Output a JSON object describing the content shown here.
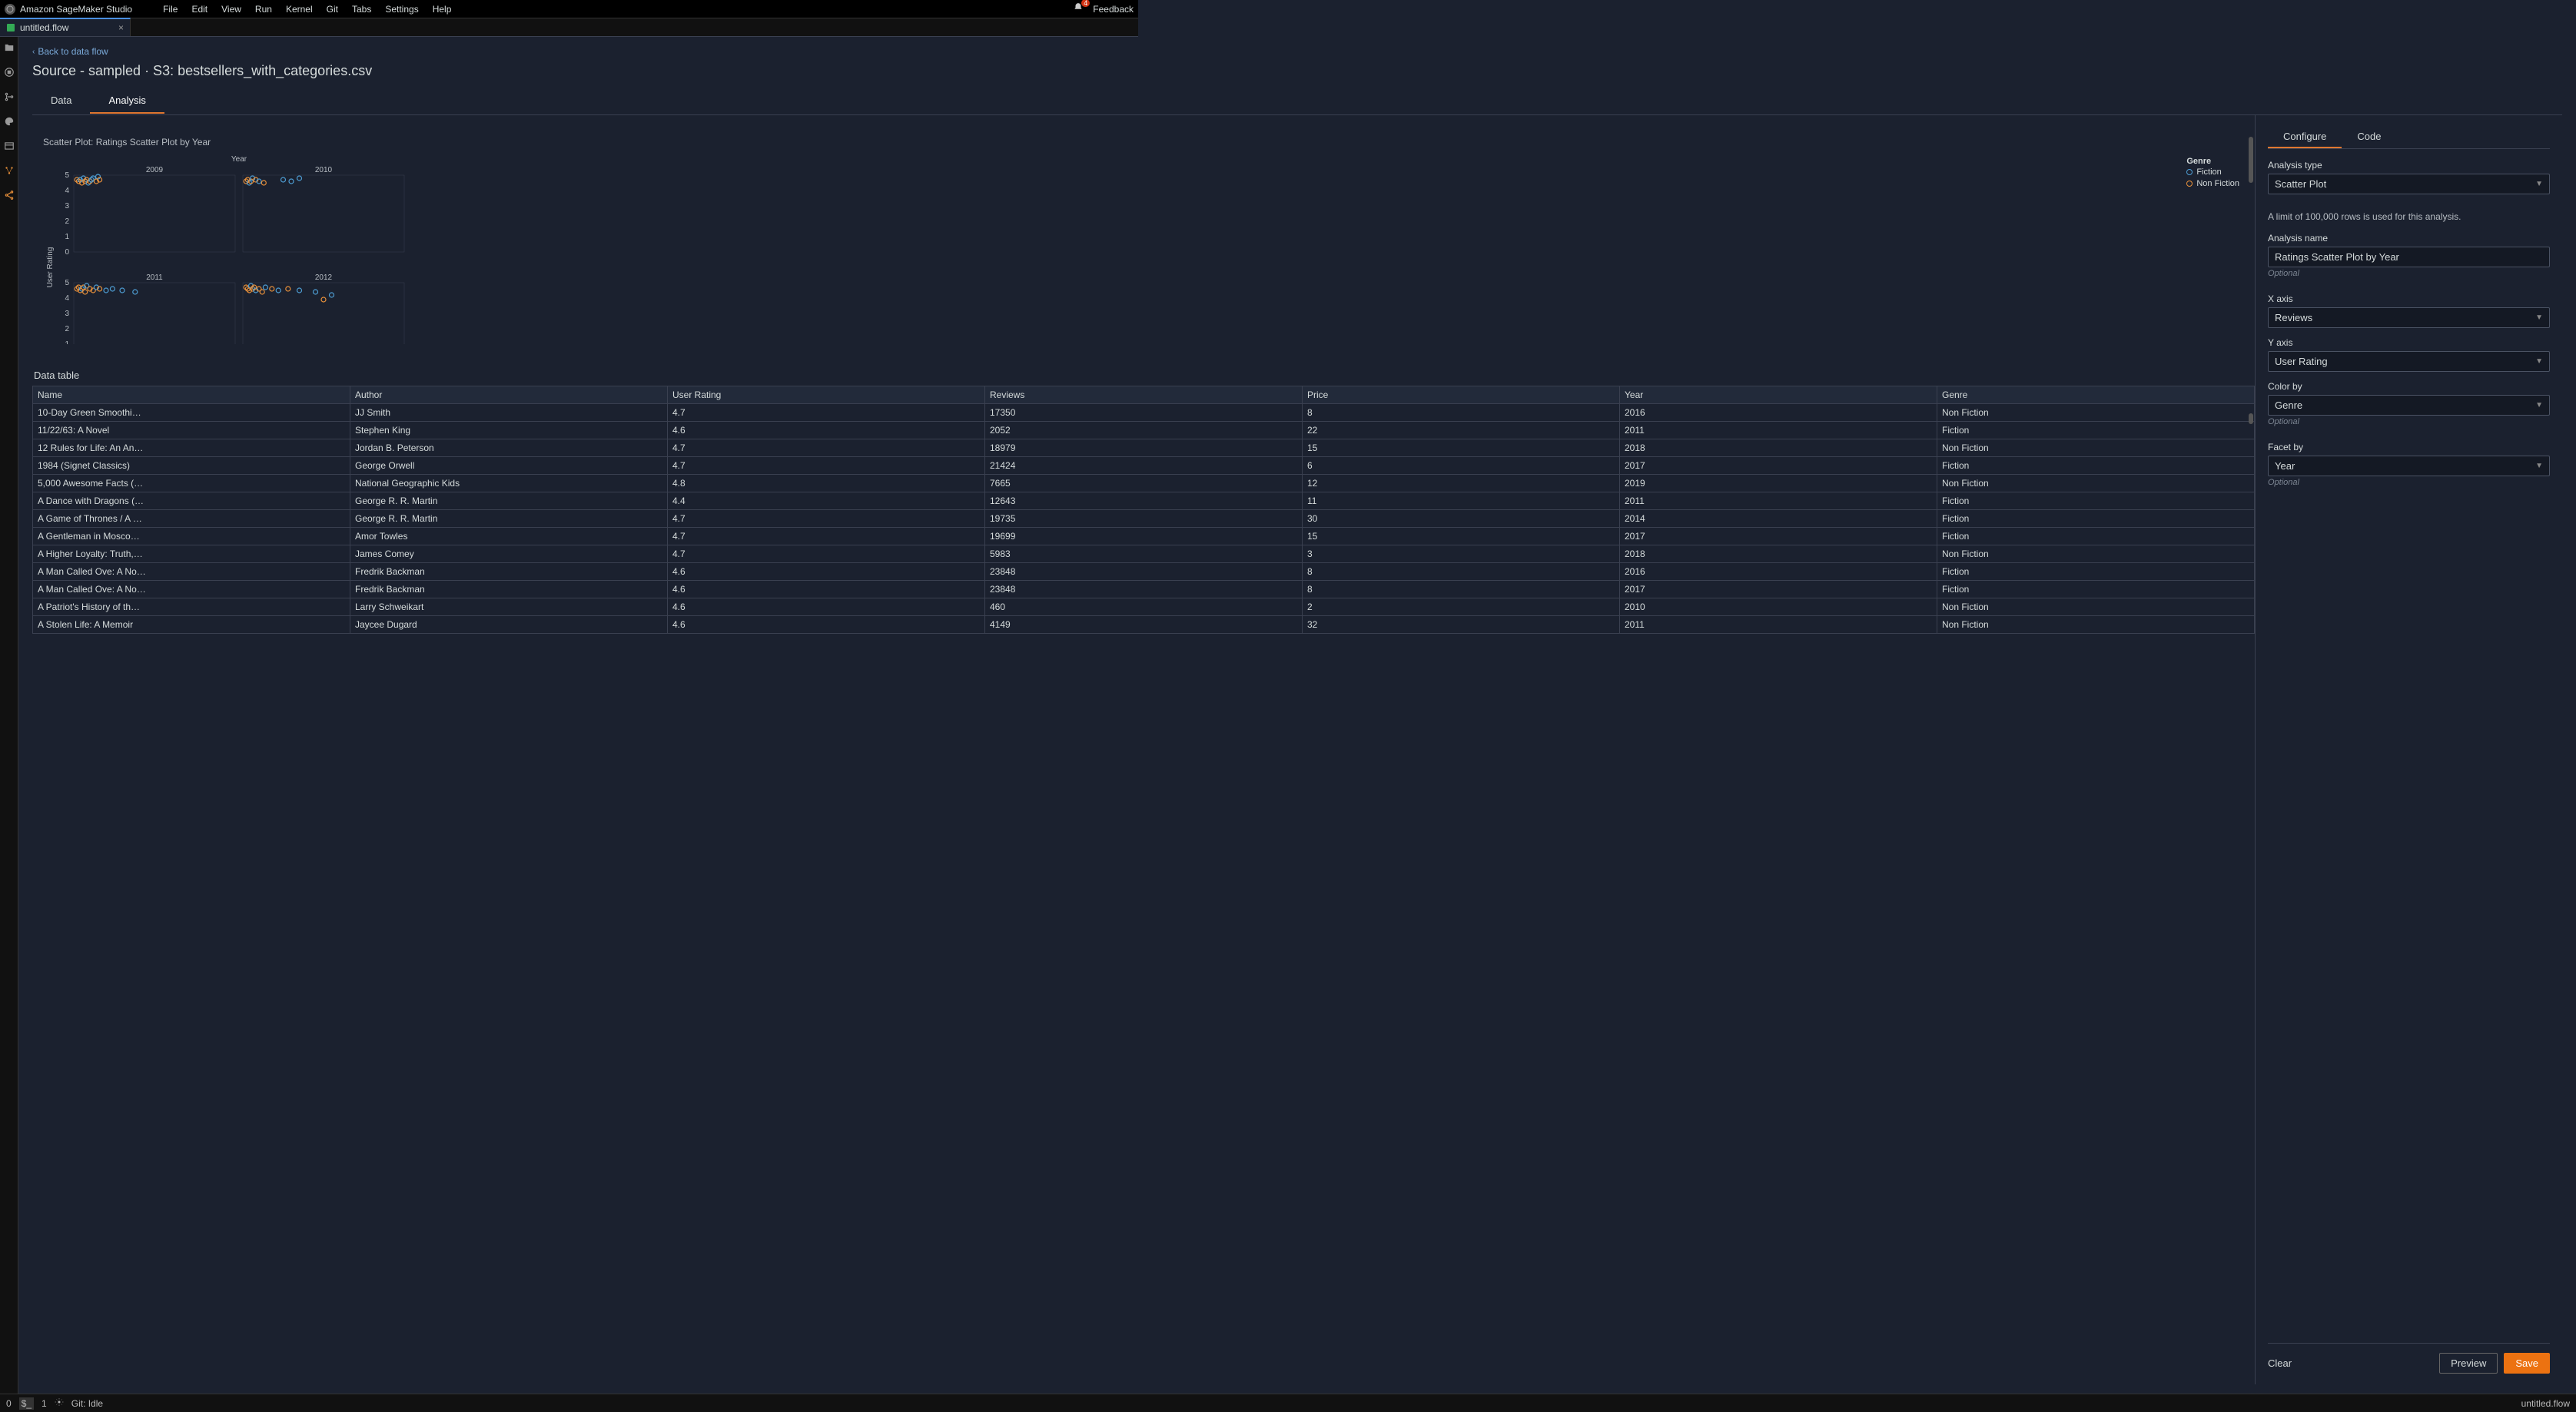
{
  "app": {
    "title": "Amazon SageMaker Studio",
    "feedback": "Feedback",
    "notification_count": "4"
  },
  "menu": [
    "File",
    "Edit",
    "View",
    "Run",
    "Kernel",
    "Git",
    "Tabs",
    "Settings",
    "Help"
  ],
  "tab": {
    "label": "untitled.flow"
  },
  "back_link": "Back to data flow",
  "page_title": "Source - sampled · S3: bestsellers_with_categories.csv",
  "view_tabs": {
    "data": "Data",
    "analysis": "Analysis"
  },
  "chart": {
    "title": "Scatter Plot: Ratings Scatter Plot by Year",
    "top_axis": "Year",
    "y_axis": "User Rating"
  },
  "legend": {
    "title": "Genre",
    "items": [
      "Fiction",
      "Non Fiction"
    ]
  },
  "data_table_label": "Data table",
  "columns": [
    "Name",
    "Author",
    "User Rating",
    "Reviews",
    "Price",
    "Year",
    "Genre"
  ],
  "rows": [
    {
      "name": "10-Day Green Smoothi…",
      "author": "JJ Smith",
      "rating": "4.7",
      "reviews": "17350",
      "price": "8",
      "year": "2016",
      "genre": "Non Fiction"
    },
    {
      "name": "11/22/63: A Novel",
      "author": "Stephen King",
      "rating": "4.6",
      "reviews": "2052",
      "price": "22",
      "year": "2011",
      "genre": "Fiction"
    },
    {
      "name": "12 Rules for Life: An An…",
      "author": "Jordan B. Peterson",
      "rating": "4.7",
      "reviews": "18979",
      "price": "15",
      "year": "2018",
      "genre": "Non Fiction"
    },
    {
      "name": "1984 (Signet Classics)",
      "author": "George Orwell",
      "rating": "4.7",
      "reviews": "21424",
      "price": "6",
      "year": "2017",
      "genre": "Fiction"
    },
    {
      "name": "5,000 Awesome Facts (…",
      "author": "National Geographic Kids",
      "rating": "4.8",
      "reviews": "7665",
      "price": "12",
      "year": "2019",
      "genre": "Non Fiction"
    },
    {
      "name": "A Dance with Dragons (…",
      "author": "George R. R. Martin",
      "rating": "4.4",
      "reviews": "12643",
      "price": "11",
      "year": "2011",
      "genre": "Fiction"
    },
    {
      "name": "A Game of Thrones / A …",
      "author": "George R. R. Martin",
      "rating": "4.7",
      "reviews": "19735",
      "price": "30",
      "year": "2014",
      "genre": "Fiction"
    },
    {
      "name": "A Gentleman in Mosco…",
      "author": "Amor Towles",
      "rating": "4.7",
      "reviews": "19699",
      "price": "15",
      "year": "2017",
      "genre": "Fiction"
    },
    {
      "name": "A Higher Loyalty: Truth,…",
      "author": "James Comey",
      "rating": "4.7",
      "reviews": "5983",
      "price": "3",
      "year": "2018",
      "genre": "Non Fiction"
    },
    {
      "name": "A Man Called Ove: A No…",
      "author": "Fredrik Backman",
      "rating": "4.6",
      "reviews": "23848",
      "price": "8",
      "year": "2016",
      "genre": "Fiction"
    },
    {
      "name": "A Man Called Ove: A No…",
      "author": "Fredrik Backman",
      "rating": "4.6",
      "reviews": "23848",
      "price": "8",
      "year": "2017",
      "genre": "Fiction"
    },
    {
      "name": "A Patriot's History of th…",
      "author": "Larry Schweikart",
      "rating": "4.6",
      "reviews": "460",
      "price": "2",
      "year": "2010",
      "genre": "Non Fiction"
    },
    {
      "name": "A Stolen Life: A Memoir",
      "author": "Jaycee Dugard",
      "rating": "4.6",
      "reviews": "4149",
      "price": "32",
      "year": "2011",
      "genre": "Non Fiction"
    }
  ],
  "config": {
    "tabs": {
      "configure": "Configure",
      "code": "Code"
    },
    "analysis_type_label": "Analysis type",
    "analysis_type": "Scatter Plot",
    "info": "A limit of 100,000 rows is used for this analysis.",
    "analysis_name_label": "Analysis name",
    "analysis_name": "Ratings Scatter Plot by Year",
    "optional": "Optional",
    "x_axis_label": "X axis",
    "x_axis": "Reviews",
    "y_axis_label": "Y axis",
    "y_axis": "User Rating",
    "color_by_label": "Color by",
    "color_by": "Genre",
    "facet_by_label": "Facet by",
    "facet_by": "Year",
    "clear": "Clear",
    "preview": "Preview",
    "save": "Save"
  },
  "status": {
    "zero": "0",
    "one": "1",
    "git": "Git: Idle",
    "file": "untitled.flow"
  },
  "chart_data": {
    "type": "scatter",
    "facets": [
      "2009",
      "2010",
      "2011",
      "2012"
    ],
    "y_ticks": [
      0,
      1,
      2,
      3,
      4,
      5
    ],
    "color_categories": [
      "Fiction",
      "Non Fiction"
    ],
    "colors": {
      "Fiction": "#4e9ed4",
      "Non Fiction": "#e8903a"
    },
    "panels": [
      {
        "facet": "2009",
        "points": [
          {
            "x": 0.02,
            "y": 4.7,
            "c": "Non Fiction"
          },
          {
            "x": 0.03,
            "y": 4.6,
            "c": "Non Fiction"
          },
          {
            "x": 0.04,
            "y": 4.7,
            "c": "Fiction"
          },
          {
            "x": 0.05,
            "y": 4.5,
            "c": "Non Fiction"
          },
          {
            "x": 0.06,
            "y": 4.8,
            "c": "Fiction"
          },
          {
            "x": 0.07,
            "y": 4.6,
            "c": "Non Fiction"
          },
          {
            "x": 0.08,
            "y": 4.7,
            "c": "Non Fiction"
          },
          {
            "x": 0.09,
            "y": 4.5,
            "c": "Fiction"
          },
          {
            "x": 0.1,
            "y": 4.6,
            "c": "Non Fiction"
          },
          {
            "x": 0.11,
            "y": 4.7,
            "c": "Fiction"
          },
          {
            "x": 0.12,
            "y": 4.8,
            "c": "Fiction"
          },
          {
            "x": 0.14,
            "y": 4.6,
            "c": "Non Fiction"
          },
          {
            "x": 0.15,
            "y": 4.9,
            "c": "Fiction"
          },
          {
            "x": 0.16,
            "y": 4.7,
            "c": "Non Fiction"
          }
        ]
      },
      {
        "facet": "2010",
        "points": [
          {
            "x": 0.02,
            "y": 4.6,
            "c": "Non Fiction"
          },
          {
            "x": 0.03,
            "y": 4.7,
            "c": "Non Fiction"
          },
          {
            "x": 0.04,
            "y": 4.5,
            "c": "Fiction"
          },
          {
            "x": 0.05,
            "y": 4.6,
            "c": "Non Fiction"
          },
          {
            "x": 0.06,
            "y": 4.8,
            "c": "Fiction"
          },
          {
            "x": 0.08,
            "y": 4.7,
            "c": "Non Fiction"
          },
          {
            "x": 0.1,
            "y": 4.6,
            "c": "Fiction"
          },
          {
            "x": 0.13,
            "y": 4.5,
            "c": "Non Fiction"
          },
          {
            "x": 0.25,
            "y": 4.7,
            "c": "Fiction"
          },
          {
            "x": 0.3,
            "y": 4.6,
            "c": "Fiction"
          },
          {
            "x": 0.35,
            "y": 4.8,
            "c": "Fiction"
          }
        ]
      },
      {
        "facet": "2011",
        "points": [
          {
            "x": 0.02,
            "y": 4.6,
            "c": "Non Fiction"
          },
          {
            "x": 0.03,
            "y": 4.7,
            "c": "Non Fiction"
          },
          {
            "x": 0.04,
            "y": 4.5,
            "c": "Non Fiction"
          },
          {
            "x": 0.05,
            "y": 4.6,
            "c": "Fiction"
          },
          {
            "x": 0.06,
            "y": 4.7,
            "c": "Non Fiction"
          },
          {
            "x": 0.07,
            "y": 4.4,
            "c": "Non Fiction"
          },
          {
            "x": 0.08,
            "y": 4.8,
            "c": "Fiction"
          },
          {
            "x": 0.1,
            "y": 4.6,
            "c": "Non Fiction"
          },
          {
            "x": 0.12,
            "y": 4.5,
            "c": "Non Fiction"
          },
          {
            "x": 0.14,
            "y": 4.7,
            "c": "Fiction"
          },
          {
            "x": 0.16,
            "y": 4.6,
            "c": "Non Fiction"
          },
          {
            "x": 0.2,
            "y": 4.5,
            "c": "Fiction"
          },
          {
            "x": 0.24,
            "y": 4.6,
            "c": "Fiction"
          },
          {
            "x": 0.3,
            "y": 4.5,
            "c": "Fiction"
          },
          {
            "x": 0.38,
            "y": 4.4,
            "c": "Fiction"
          }
        ]
      },
      {
        "facet": "2012",
        "points": [
          {
            "x": 0.02,
            "y": 4.7,
            "c": "Non Fiction"
          },
          {
            "x": 0.03,
            "y": 4.6,
            "c": "Non Fiction"
          },
          {
            "x": 0.04,
            "y": 4.5,
            "c": "Non Fiction"
          },
          {
            "x": 0.05,
            "y": 4.8,
            "c": "Fiction"
          },
          {
            "x": 0.06,
            "y": 4.6,
            "c": "Non Fiction"
          },
          {
            "x": 0.07,
            "y": 4.7,
            "c": "Non Fiction"
          },
          {
            "x": 0.08,
            "y": 4.5,
            "c": "Fiction"
          },
          {
            "x": 0.1,
            "y": 4.6,
            "c": "Non Fiction"
          },
          {
            "x": 0.12,
            "y": 4.4,
            "c": "Non Fiction"
          },
          {
            "x": 0.14,
            "y": 4.7,
            "c": "Fiction"
          },
          {
            "x": 0.18,
            "y": 4.6,
            "c": "Non Fiction"
          },
          {
            "x": 0.22,
            "y": 4.5,
            "c": "Fiction"
          },
          {
            "x": 0.28,
            "y": 4.6,
            "c": "Non Fiction"
          },
          {
            "x": 0.35,
            "y": 4.5,
            "c": "Fiction"
          },
          {
            "x": 0.45,
            "y": 4.4,
            "c": "Fiction"
          },
          {
            "x": 0.55,
            "y": 4.2,
            "c": "Fiction"
          },
          {
            "x": 0.5,
            "y": 3.9,
            "c": "Non Fiction"
          }
        ]
      }
    ]
  }
}
